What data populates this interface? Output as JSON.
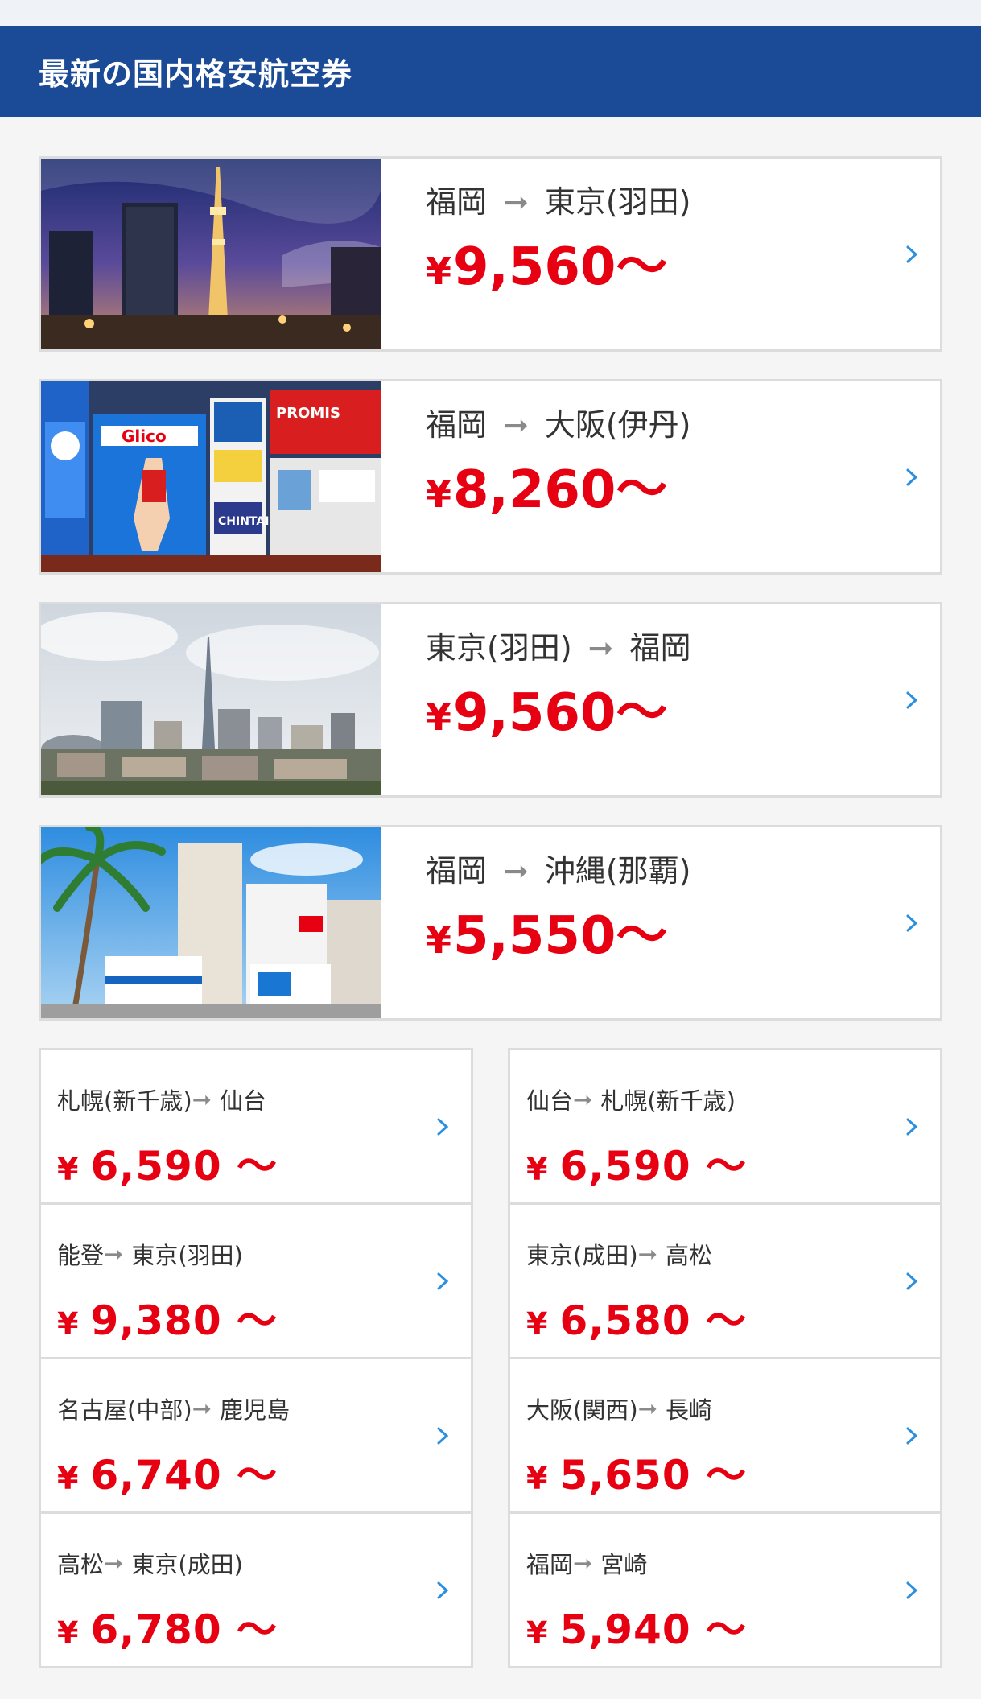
{
  "header": {
    "title": "最新の国内格安航空券"
  },
  "featured": [
    {
      "from": "福岡",
      "to": "東京(羽田)",
      "yen": "¥",
      "price": "9,560～",
      "image": "tokyo-skytree-night"
    },
    {
      "from": "福岡",
      "to": "大阪(伊丹)",
      "yen": "¥",
      "price": "8,260～",
      "image": "osaka-dotonbori-signs"
    },
    {
      "from": "東京(羽田)",
      "to": "福岡",
      "yen": "¥",
      "price": "9,560～",
      "image": "fukuoka-tower-skyline"
    },
    {
      "from": "福岡",
      "to": "沖縄(那覇)",
      "yen": "¥",
      "price": "5,550～",
      "image": "okinawa-palm-street"
    }
  ],
  "arrow_glyph": "➞",
  "grid_left": [
    {
      "from": "札幌(新千歳)",
      "to": "仙台",
      "yen": "¥",
      "price": "6,590 ～"
    },
    {
      "from": "能登",
      "to": "東京(羽田)",
      "yen": "¥",
      "price": "9,380 ～"
    },
    {
      "from": "名古屋(中部)",
      "to": "鹿児島",
      "yen": "¥",
      "price": "6,740 ～"
    },
    {
      "from": "高松",
      "to": "東京(成田)",
      "yen": "¥",
      "price": "6,780 ～"
    }
  ],
  "grid_right": [
    {
      "from": "仙台",
      "to": "札幌(新千歳)",
      "yen": "¥",
      "price": "6,590 ～"
    },
    {
      "from": "東京(成田)",
      "to": "高松",
      "yen": "¥",
      "price": "6,580 ～"
    },
    {
      "from": "大阪(関西)",
      "to": "長崎",
      "yen": "¥",
      "price": "5,650 ～"
    },
    {
      "from": "福岡",
      "to": "宮崎",
      "yen": "¥",
      "price": "5,940 ～"
    }
  ],
  "colors": {
    "header_bg": "#1b4a96",
    "price_red": "#e60012",
    "chevron_blue": "#2b8fe0"
  }
}
